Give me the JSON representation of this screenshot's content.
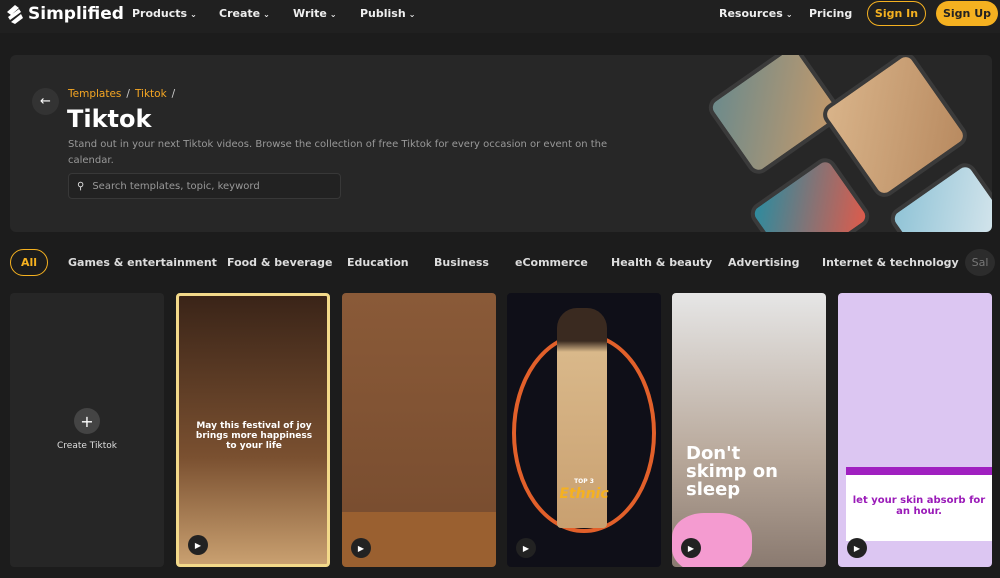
{
  "nav": {
    "brand": "Simplified",
    "menus": [
      "Products",
      "Create",
      "Write",
      "Publish",
      "Resources",
      "Pricing"
    ],
    "sign_in": "Sign In",
    "sign_up": "Sign Up"
  },
  "hero": {
    "breadcrumb": [
      "Templates",
      "Tiktok"
    ],
    "title": "Tiktok",
    "description": "Stand out in your next Tiktok videos. Browse the collection of free Tiktok for every occasion or event on the calendar.",
    "search_placeholder": "Search templates, topic, keyword"
  },
  "tabs": [
    "All",
    "Games & entertainment",
    "Food & beverage",
    "Education",
    "Business",
    "eCommerce",
    "Health & beauty",
    "Advertising",
    "Internet & technology",
    "Sal"
  ],
  "create": {
    "label": "Create Tiktok"
  },
  "cards": [
    {
      "text": "May this festival of joy brings more happiness to your life"
    },
    {
      "text": ""
    },
    {
      "top": "TOP 3",
      "text": "Ethnic"
    },
    {
      "text": "Don't skimp on sleep"
    },
    {
      "text": "let your skin absorb for an hour."
    }
  ],
  "colors": {
    "accent": "#f5b120",
    "background": "#1c1c1c"
  }
}
